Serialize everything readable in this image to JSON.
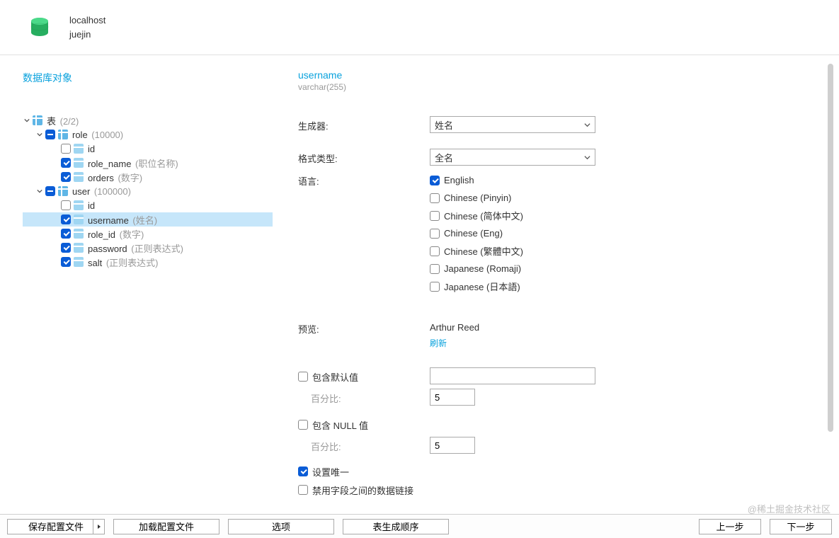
{
  "header": {
    "host": "localhost",
    "database": "juejin"
  },
  "sidebar": {
    "title": "数据库对象",
    "root": {
      "label": "表",
      "count": "(2/2)"
    },
    "tables": [
      {
        "name": "role",
        "count": "(10000)",
        "columns": [
          {
            "name": "id",
            "hint": "",
            "checked": false
          },
          {
            "name": "role_name",
            "hint": "(职位名称)",
            "checked": true
          },
          {
            "name": "orders",
            "hint": "(数字)",
            "checked": true
          }
        ]
      },
      {
        "name": "user",
        "count": "(100000)",
        "columns": [
          {
            "name": "id",
            "hint": "",
            "checked": false
          },
          {
            "name": "username",
            "hint": "(姓名)",
            "checked": true,
            "selected": true
          },
          {
            "name": "role_id",
            "hint": "(数字)",
            "checked": true
          },
          {
            "name": "password",
            "hint": "(正则表达式)",
            "checked": true
          },
          {
            "name": "salt",
            "hint": "(正则表达式)",
            "checked": true
          }
        ]
      }
    ]
  },
  "main": {
    "column_name": "username",
    "column_type": "varchar(255)",
    "labels": {
      "generator": "生成器:",
      "format_type": "格式类型:",
      "language": "语言:",
      "preview": "预览:",
      "refresh": "刷新",
      "include_default": "包含默认值",
      "pct": "百分比:",
      "include_null": "包含 NULL 值",
      "set_unique": "设置唯一",
      "disable_link": "禁用字段之间的数据链接"
    },
    "generator_value": "姓名",
    "format_value": "全名",
    "languages": [
      {
        "label": "English",
        "checked": true
      },
      {
        "label": "Chinese (Pinyin)",
        "checked": false
      },
      {
        "label": "Chinese (简体中文)",
        "checked": false
      },
      {
        "label": "Chinese (Eng)",
        "checked": false
      },
      {
        "label": "Chinese (繁體中文)",
        "checked": false
      },
      {
        "label": "Japanese (Romaji)",
        "checked": false
      },
      {
        "label": "Japanese (日本語)",
        "checked": false
      }
    ],
    "preview_value": "Arthur Reed",
    "default_value_input": "",
    "default_pct": "5",
    "null_pct": "5",
    "include_default_checked": false,
    "include_null_checked": false,
    "set_unique_checked": true,
    "disable_link_checked": false
  },
  "footer": {
    "save_profile": "保存配置文件",
    "load_profile": "加载配置文件",
    "options": "选项",
    "gen_order": "表生成顺序",
    "prev": "上一步",
    "next": "下一步"
  },
  "watermark": "@稀土掘金技术社区"
}
